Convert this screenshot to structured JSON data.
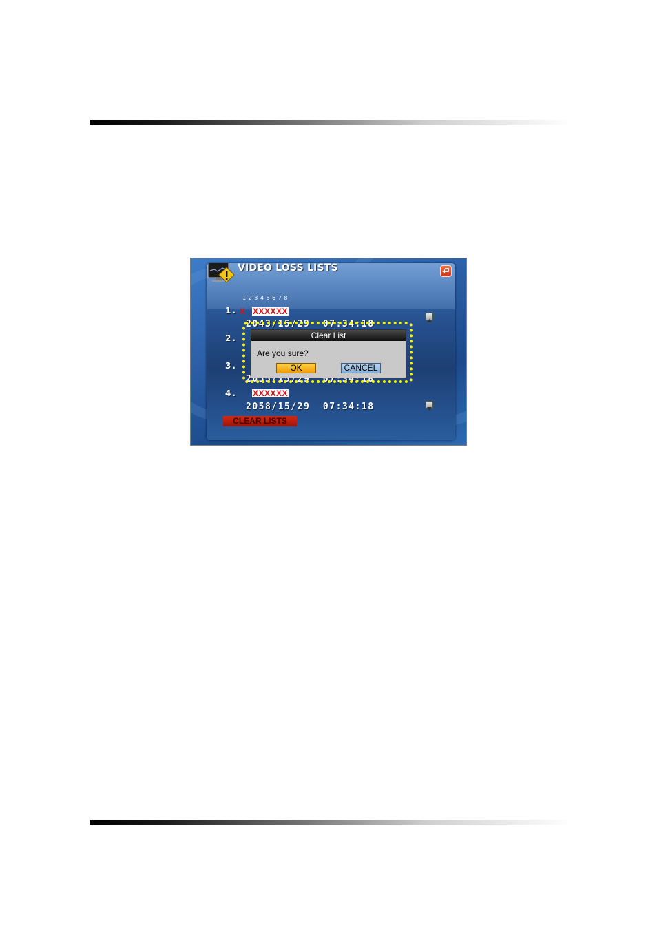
{
  "screen": {
    "title": "VIDEO LOSS LISTS",
    "channel_header": "1 2 3 4 5 6 7 8",
    "entries": [
      {
        "index": "1.",
        "channels": "X",
        "placeholder": "XXXXXX",
        "timestamp": "2043/15/29  07:34:18"
      },
      {
        "index": "2.",
        "placeholder": "",
        "timestamp": ""
      },
      {
        "index": "3.",
        "placeholder": "",
        "timestamp": "2055/15/29  07:34:18"
      },
      {
        "index": "4.",
        "placeholder": "XXXXXX",
        "timestamp": "2058/15/29  07:34:18"
      }
    ],
    "clear_lists_label": "CLEAR LISTS",
    "dialog": {
      "title": "Clear List",
      "message": "Are you sure?",
      "ok_label": "OK",
      "cancel_label": "CANCEL"
    }
  },
  "icons": {
    "title": "warning-monitor-icon",
    "return": "return-arrow-icon",
    "scroll_up": "scroll-up-icon",
    "scroll_down": "scroll-down-icon"
  },
  "colors": {
    "highlight": "#f4f20e",
    "loss_marker": "#e01010",
    "ok_button": "#f5b800",
    "cancel_button": "#a6c6e6",
    "clear_lists_button": "#c0200e"
  }
}
